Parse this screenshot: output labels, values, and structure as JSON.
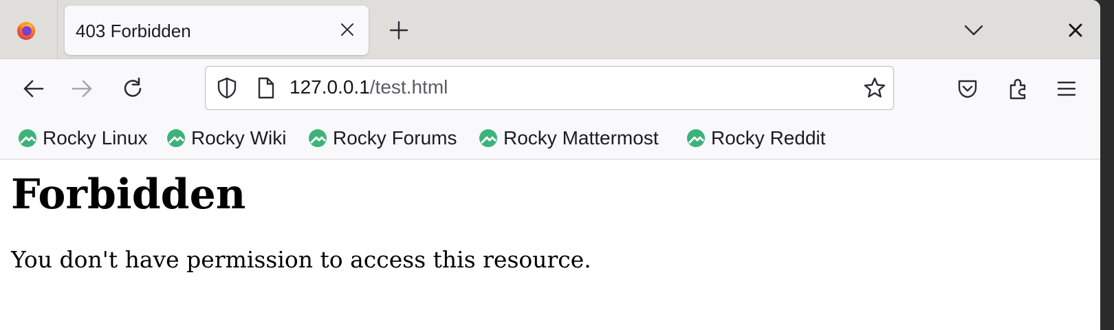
{
  "browser": {
    "tab": {
      "title": "403 Forbidden"
    },
    "address": {
      "host": "127.0.0.1",
      "path": "/test.html"
    },
    "bookmarks": [
      {
        "label": "Rocky Linux"
      },
      {
        "label": "Rocky Wiki"
      },
      {
        "label": "Rocky Forums"
      },
      {
        "label": "Rocky Mattermost"
      },
      {
        "label": "Rocky Reddit"
      }
    ],
    "colors": {
      "rocky_green": "#3db37a",
      "tabstrip": "#e0dedb",
      "toolbar": "#f9f9fb"
    }
  },
  "page": {
    "heading": "Forbidden",
    "message": "You don't have permission to access this resource."
  }
}
